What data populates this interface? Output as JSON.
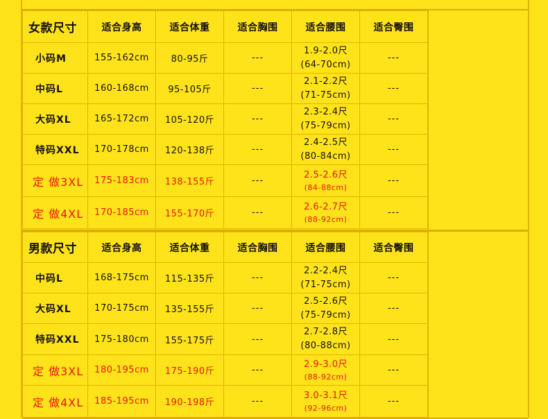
{
  "colors": {
    "background": "#FFE31A",
    "grid": "#E2B500",
    "accent_red": "#E8160C"
  },
  "women": {
    "headers": [
      "女款尺寸",
      "适合身高",
      "适合体重",
      "适合胸围",
      "适合腰围",
      "适合臀围"
    ],
    "rows": [
      {
        "size": "小码M",
        "height": "155-162cm",
        "weight": "80-95斤",
        "chest": "---",
        "waist1": "1.9-2.0尺",
        "waist2": "(64-70cm)",
        "hip": "---",
        "red": false
      },
      {
        "size": "中码L",
        "height": "160-168cm",
        "weight": "95-105斤",
        "chest": "---",
        "waist1": "2.1-2.2尺",
        "waist2": "(71-75cm)",
        "hip": "---",
        "red": false
      },
      {
        "size": "大码XL",
        "height": "165-172cm",
        "weight": "105-120斤",
        "chest": "---",
        "waist1": "2.3-2.4尺",
        "waist2": "(75-79cm)",
        "hip": "---",
        "red": false
      },
      {
        "size": "特码XXL",
        "height": "170-178cm",
        "weight": "120-138斤",
        "chest": "---",
        "waist1": "2.4-2.5尺",
        "waist2": "(80-84cm)",
        "hip": "---",
        "red": false
      },
      {
        "size": "定 做3XL",
        "height": "175-183cm",
        "weight": "138-155斤",
        "chest": "---",
        "waist1": "2.5-2.6尺",
        "waist2": "(84-88cm)",
        "hip": "---",
        "red": true
      },
      {
        "size": "定 做4XL",
        "height": "170-185cm",
        "weight": "155-170斤",
        "chest": "---",
        "waist1": "2.6-2.7尺",
        "waist2": "(88-92cm)",
        "hip": "---",
        "red": true
      }
    ]
  },
  "men": {
    "headers": [
      "男款尺寸",
      "适合身高",
      "适合体重",
      "适合胸围",
      "适合腰围",
      "适合臀围"
    ],
    "rows": [
      {
        "size": "中码L",
        "height": "168-175cm",
        "weight": "115-135斤",
        "chest": "---",
        "waist1": "2.2-2.4尺",
        "waist2": "(71-75cm)",
        "hip": "---",
        "red": false
      },
      {
        "size": "大码XL",
        "height": "170-175cm",
        "weight": "135-155斤",
        "chest": "---",
        "waist1": "2.5-2.6尺",
        "waist2": "(75-79cm)",
        "hip": "---",
        "red": false
      },
      {
        "size": "特码XXL",
        "height": "175-180cm",
        "weight": "155-175斤",
        "chest": "---",
        "waist1": "2.7-2.8尺",
        "waist2": "(80-88cm)",
        "hip": "---",
        "red": false
      },
      {
        "size": "定 做3XL",
        "height": "180-195cm",
        "weight": "175-190斤",
        "chest": "---",
        "waist1": "2.9-3.0尺",
        "waist2": "(88-92cm)",
        "hip": "---",
        "red": true
      },
      {
        "size": "定 做4XL",
        "height": "185-195cm",
        "weight": "190-198斤",
        "chest": "---",
        "waist1": "3.0-3.1尺",
        "waist2": "(92-96cm)",
        "hip": "---",
        "red": true
      }
    ]
  }
}
